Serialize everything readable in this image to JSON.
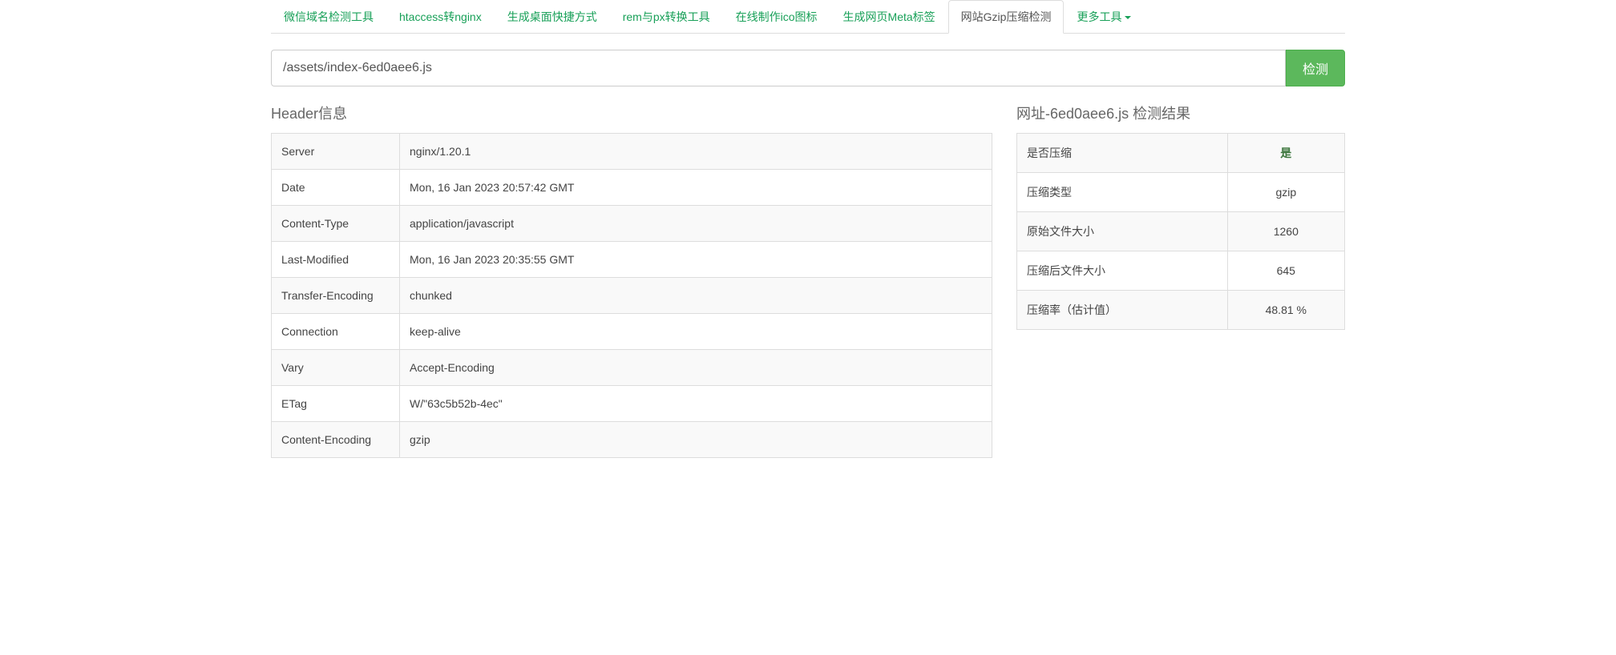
{
  "tabs": [
    {
      "label": "微信域名检测工具"
    },
    {
      "label": "htaccess转nginx"
    },
    {
      "label": "生成桌面快捷方式"
    },
    {
      "label": "rem与px转换工具"
    },
    {
      "label": "在线制作ico图标"
    },
    {
      "label": "生成网页Meta标签"
    },
    {
      "label": "网站Gzip压缩检测"
    },
    {
      "label": "更多工具"
    }
  ],
  "input": {
    "value": "/assets/index-6ed0aee6.js",
    "button": "检测"
  },
  "header_section_title": "Header信息",
  "headers": [
    {
      "k": "Server",
      "v": "nginx/1.20.1"
    },
    {
      "k": "Date",
      "v": "Mon, 16 Jan 2023 20:57:42 GMT"
    },
    {
      "k": "Content-Type",
      "v": "application/javascript"
    },
    {
      "k": "Last-Modified",
      "v": "Mon, 16 Jan 2023 20:35:55 GMT"
    },
    {
      "k": "Transfer-Encoding",
      "v": "chunked"
    },
    {
      "k": "Connection",
      "v": "keep-alive"
    },
    {
      "k": "Vary",
      "v": "Accept-Encoding"
    },
    {
      "k": "ETag",
      "v": "W/\"63c5b52b-4ec\""
    },
    {
      "k": "Content-Encoding",
      "v": "gzip"
    }
  ],
  "result_title_prefix": "网址",
  "result_title_mid": "-6ed0aee6.js",
  "result_title_suffix": " 检测结果",
  "result": [
    {
      "k": "是否压缩",
      "v": "是",
      "success": true
    },
    {
      "k": "压缩类型",
      "v": "gzip"
    },
    {
      "k": "原始文件大小",
      "v": "1260"
    },
    {
      "k": "压缩后文件大小",
      "v": "645"
    },
    {
      "k": "压缩率（估计值）",
      "v": "48.81 %"
    }
  ]
}
